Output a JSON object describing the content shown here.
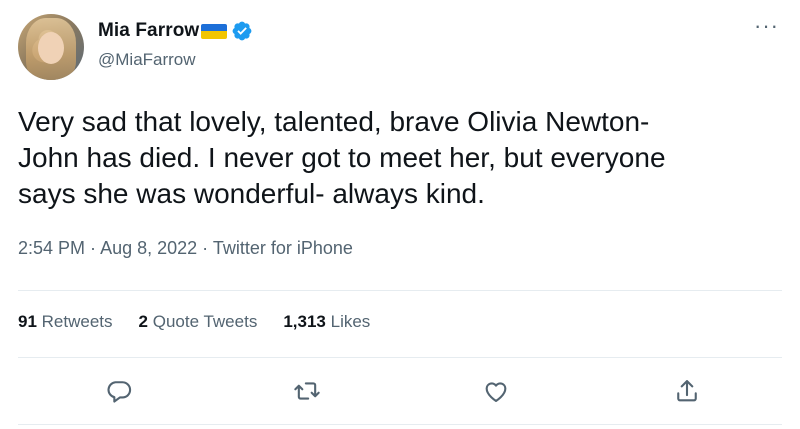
{
  "user": {
    "display_name": "Mia Farrow",
    "handle": "@MiaFarrow",
    "verified": true
  },
  "icons": {
    "flag": "ukraine-flag-emoji",
    "verified": "verified-badge-icon",
    "more": "more-options-icon",
    "reply": "reply-icon",
    "retweet": "retweet-icon",
    "like": "like-icon",
    "share": "share-icon"
  },
  "tweet": {
    "lines": [
      "Very sad that lovely, talented, brave Olivia Newton-",
      "John has died. I never got to meet her, but everyone",
      "says she was wonderful- always kind."
    ]
  },
  "meta": {
    "time": "2:54 PM",
    "date": "Aug 8, 2022",
    "source": "Twitter for iPhone",
    "separator": " · "
  },
  "stats": {
    "retweets_count": "91",
    "retweets_label": "Retweets",
    "quotes_count": "2",
    "quotes_label": "Quote Tweets",
    "likes_count": "1,313",
    "likes_label": "Likes"
  },
  "colors": {
    "text": "#0f1419",
    "secondary": "#536471",
    "verified_blue": "#1d9bf0",
    "divider": "#e6ecf0"
  }
}
